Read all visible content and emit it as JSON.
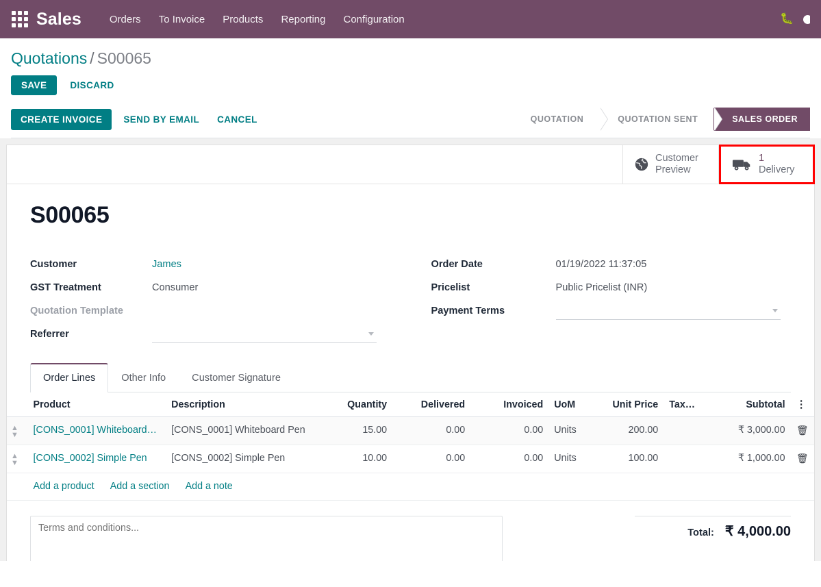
{
  "navbar": {
    "apps_icon": "apps-grid-icon",
    "brand": "Sales",
    "menu": [
      {
        "label": "Orders"
      },
      {
        "label": "To Invoice"
      },
      {
        "label": "Products"
      },
      {
        "label": "Reporting"
      },
      {
        "label": "Configuration"
      }
    ],
    "bug_icon": "bug-icon",
    "accent_color": "#714B67"
  },
  "breadcrumb": {
    "parent": "Quotations",
    "separator": "/",
    "current": "S00065"
  },
  "save_bar": {
    "save_label": "SAVE",
    "discard_label": "DISCARD"
  },
  "action_bar": {
    "primary_label": "CREATE INVOICE",
    "secondary_labels": [
      "SEND BY EMAIL",
      "CANCEL"
    ],
    "statusbar": {
      "stages": [
        {
          "label": "QUOTATION",
          "active": false
        },
        {
          "label": "QUOTATION SENT",
          "active": false
        },
        {
          "label": "SALES ORDER",
          "active": true
        }
      ],
      "active_color": "#714B67"
    }
  },
  "stat_buttons": [
    {
      "icon": "globe-icon",
      "line1": "Customer",
      "line2": "Preview",
      "count": "",
      "highlighted": false
    },
    {
      "icon": "truck-icon",
      "line1": "1",
      "line2": "Delivery",
      "count": "1",
      "highlighted": true,
      "highlight_color": "#ff0000"
    }
  ],
  "record": {
    "title": "S00065"
  },
  "form": {
    "left": [
      {
        "label": "Customer",
        "value": "James",
        "type": "link"
      },
      {
        "label": "GST Treatment",
        "value": "Consumer",
        "type": "text"
      },
      {
        "label": "Quotation Template",
        "value": "",
        "type": "text",
        "muted_label": true
      },
      {
        "label": "Referrer",
        "value": "",
        "type": "select"
      }
    ],
    "right": [
      {
        "label": "Order Date",
        "value": "01/19/2022 11:37:05",
        "type": "text"
      },
      {
        "label": "Pricelist",
        "value": "Public Pricelist (INR)",
        "type": "text"
      },
      {
        "label": "Payment Terms",
        "value": "",
        "type": "select"
      }
    ]
  },
  "notebook": {
    "tabs": [
      {
        "label": "Order Lines",
        "active": true
      },
      {
        "label": "Other Info",
        "active": false
      },
      {
        "label": "Customer Signature",
        "active": false
      }
    ]
  },
  "order_lines": {
    "columns": [
      "Product",
      "Description",
      "Quantity",
      "Delivered",
      "Invoiced",
      "UoM",
      "Unit Price",
      "Tax…",
      "Subtotal"
    ],
    "kebab_icon": "column-options-icon",
    "rows": [
      {
        "handle": "drag-handle-icon",
        "product": "[CONS_0001] Whiteboard…",
        "description": "[CONS_0001] Whiteboard Pen",
        "quantity": "15.00",
        "delivered": "0.00",
        "invoiced": "0.00",
        "uom": "Units",
        "unit_price": "200.00",
        "tax": "",
        "subtotal": "₹ 3,000.00",
        "delete_icon": "trash-icon"
      },
      {
        "handle": "drag-handle-icon",
        "product": "[CONS_0002] Simple Pen",
        "description": "[CONS_0002] Simple Pen",
        "quantity": "10.00",
        "delivered": "0.00",
        "invoiced": "0.00",
        "uom": "Units",
        "unit_price": "100.00",
        "tax": "",
        "subtotal": "₹ 1,000.00",
        "delete_icon": "trash-icon"
      }
    ],
    "add_links": [
      "Add a product",
      "Add a section",
      "Add a note"
    ]
  },
  "footer": {
    "terms_placeholder": "Terms and conditions...",
    "total_label": "Total:",
    "total_value": "₹ 4,000.00"
  }
}
